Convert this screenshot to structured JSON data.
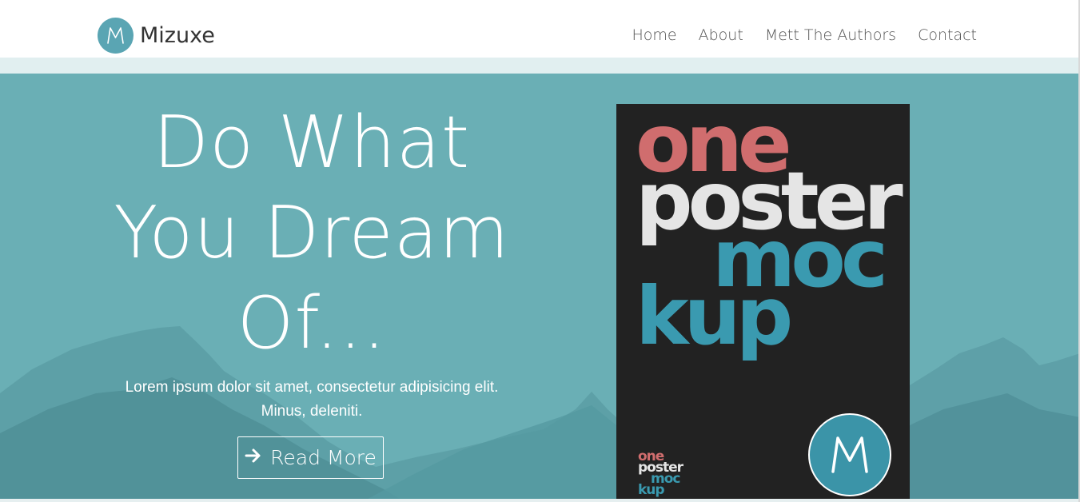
{
  "navbar": {
    "brand": {
      "logo_letter": "M",
      "name": "Mizuxe"
    },
    "links": [
      {
        "label": "Home"
      },
      {
        "label": "About"
      },
      {
        "label": "Mett The Authors"
      },
      {
        "label": "Contact"
      }
    ]
  },
  "hero": {
    "title_lines": [
      "Do What",
      "You Dream",
      "Of..."
    ],
    "subtitle_lines": [
      "Lorem ipsum dolor sit amet, consectetur adipisicing elit.",
      "Minus, deleniti."
    ],
    "button_label": "Read More",
    "button_icon": "arrow-right-icon"
  },
  "poster": {
    "big_text": [
      "one",
      "poster",
      "moc",
      "kup"
    ],
    "small_text": [
      "one",
      "poster",
      "moc",
      "kup"
    ],
    "badge_letter": "M"
  },
  "colors": {
    "hero_bg": "#6aafb5",
    "brand_logo": "#5aa5b3",
    "poster_bg": "#222222",
    "poster_red": "#d06d6e",
    "poster_teal": "#3a9ab0",
    "poster_light": "#e5e5e5"
  }
}
